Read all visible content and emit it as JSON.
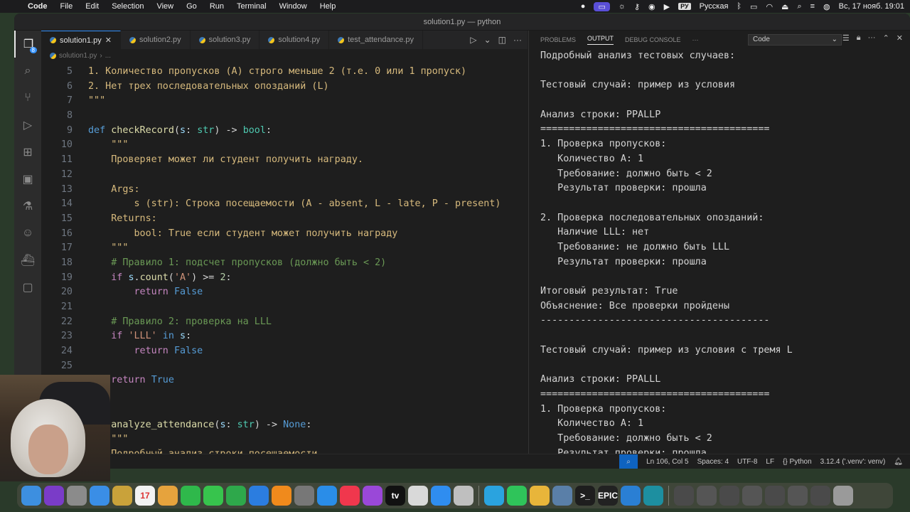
{
  "menubar": {
    "app": "Code",
    "items": [
      "File",
      "Edit",
      "Selection",
      "View",
      "Go",
      "Run",
      "Terminal",
      "Window",
      "Help"
    ],
    "input_source_badge": "РУ",
    "input_source": "Русская",
    "datetime": "Вс, 17 нояб.  19:01"
  },
  "window": {
    "title": "solution1.py — python"
  },
  "activity_bar": {
    "icons": [
      "files-icon",
      "search-icon",
      "source-control-icon",
      "run-debug-icon",
      "extensions-icon",
      "remote-explorer-icon",
      "testing-icon",
      "copilot-icon",
      "docker-icon",
      "comments-icon"
    ],
    "explorer_badge": "8"
  },
  "editor": {
    "tabs": [
      {
        "label": "solution1.py",
        "active": true
      },
      {
        "label": "solution2.py",
        "active": false
      },
      {
        "label": "solution3.py",
        "active": false
      },
      {
        "label": "solution4.py",
        "active": false
      },
      {
        "label": "test_attendance.py",
        "active": false
      }
    ],
    "breadcrumb": [
      "solution1.py",
      "..."
    ],
    "lines": [
      {
        "n": "5",
        "segs": [
          [
            "doc",
            "1. Количество пропусков (A) строго меньше 2 (т.е. 0 или 1 пропуск)"
          ]
        ]
      },
      {
        "n": "6",
        "segs": [
          [
            "doc",
            "2. Нет трех последовательных опозданий (L)"
          ]
        ]
      },
      {
        "n": "7",
        "segs": [
          [
            "doc",
            "\"\"\""
          ]
        ]
      },
      {
        "n": "8",
        "segs": []
      },
      {
        "n": "9",
        "segs": [
          [
            "kw",
            "def "
          ],
          [
            "fn",
            "checkRecord"
          ],
          [
            "",
            "("
          ],
          [
            "var",
            "s"
          ],
          [
            "",
            ": "
          ],
          [
            "ty",
            "str"
          ],
          [
            "",
            ") -> "
          ],
          [
            "ty",
            "bool"
          ],
          [
            "",
            ":"
          ]
        ]
      },
      {
        "n": "10",
        "segs": [
          [
            "doc",
            "    \"\"\""
          ]
        ]
      },
      {
        "n": "11",
        "segs": [
          [
            "doc",
            "    Проверяет может ли студент получить награду."
          ]
        ]
      },
      {
        "n": "12",
        "segs": []
      },
      {
        "n": "13",
        "segs": [
          [
            "doc",
            "    Args:"
          ]
        ]
      },
      {
        "n": "14",
        "segs": [
          [
            "doc",
            "        s (str): Строка посещаемости (A - absent, L - late, P - present)"
          ]
        ]
      },
      {
        "n": "15",
        "segs": [
          [
            "doc",
            "    Returns:"
          ]
        ]
      },
      {
        "n": "16",
        "segs": [
          [
            "doc",
            "        bool: True если студент может получить награду"
          ]
        ]
      },
      {
        "n": "17",
        "segs": [
          [
            "doc",
            "    \"\"\""
          ]
        ]
      },
      {
        "n": "18",
        "segs": [
          [
            "cm",
            "    # Правило 1: подсчет пропусков (должно быть < 2)"
          ]
        ]
      },
      {
        "n": "19",
        "segs": [
          [
            "ctl",
            "    if "
          ],
          [
            "var",
            "s"
          ],
          [
            "",
            "."
          ],
          [
            "fn",
            "count"
          ],
          [
            "",
            "("
          ],
          [
            "str",
            "'A'"
          ],
          [
            "",
            ") >= "
          ],
          [
            "num",
            "2"
          ],
          [
            "",
            ":"
          ]
        ]
      },
      {
        "n": "20",
        "segs": [
          [
            "ctl",
            "        return "
          ],
          [
            "kw",
            "False"
          ]
        ]
      },
      {
        "n": "21",
        "segs": []
      },
      {
        "n": "22",
        "segs": [
          [
            "cm",
            "    # Правило 2: проверка на LLL"
          ]
        ]
      },
      {
        "n": "23",
        "segs": [
          [
            "ctl",
            "    if "
          ],
          [
            "str",
            "'LLL'"
          ],
          [
            "kw",
            " in "
          ],
          [
            "var",
            "s"
          ],
          [
            "",
            ":"
          ]
        ]
      },
      {
        "n": "24",
        "segs": [
          [
            "ctl",
            "        return "
          ],
          [
            "kw",
            "False"
          ]
        ]
      },
      {
        "n": "25",
        "segs": []
      },
      {
        "n": "",
        "segs": [
          [
            "ctl",
            "    return "
          ],
          [
            "kw",
            "True"
          ]
        ]
      },
      {
        "n": "",
        "segs": []
      },
      {
        "n": "",
        "segs": []
      },
      {
        "n": "",
        "segs": [
          [
            "kw",
            "def "
          ],
          [
            "fn",
            "analyze_attendance"
          ],
          [
            "",
            "("
          ],
          [
            "var",
            "s"
          ],
          [
            "",
            ": "
          ],
          [
            "ty",
            "str"
          ],
          [
            "",
            ") -> "
          ],
          [
            "kw",
            "None"
          ],
          [
            "",
            ":"
          ]
        ]
      },
      {
        "n": "",
        "segs": [
          [
            "doc",
            "    \"\"\""
          ]
        ]
      },
      {
        "n": "",
        "segs": [
          [
            "doc",
            "    Подробный анализ строки посещаемости"
          ]
        ]
      }
    ]
  },
  "panel": {
    "tabs": [
      "PROBLEMS",
      "OUTPUT",
      "DEBUG CONSOLE",
      "···"
    ],
    "active_tab": "OUTPUT",
    "channel": "Code",
    "output_lines": [
      "Подробный анализ тестовых случаев:",
      "",
      "Тестовый случай: пример из условия",
      "",
      "Анализ строки: PPALLP",
      "========================================",
      "1. Проверка пропусков:",
      "   Количество A: 1",
      "   Требование: должно быть < 2",
      "   Результат проверки: прошла",
      "",
      "2. Проверка последовательных опозданий:",
      "   Наличие LLL: нет",
      "   Требование: не должно быть LLL",
      "   Результат проверки: прошла",
      "",
      "Итоговый результат: True",
      "Объяснение: Все проверки пройдены",
      "----------------------------------------",
      "",
      "Тестовый случай: пример из условия с тремя L",
      "",
      "Анализ строки: PPALLL",
      "========================================",
      "1. Проверка пропусков:",
      "   Количество A: 1",
      "   Требование: должно быть < 2",
      "   Результат проверки: прошла"
    ]
  },
  "statusbar": {
    "position": "Ln 106, Col 5",
    "indent": "Spaces: 4",
    "encoding": "UTF-8",
    "eol": "LF",
    "language": "{} Python",
    "interpreter": "3.12.4 ('.venv': venv)"
  },
  "dock": {
    "apps": [
      {
        "name": "finder",
        "color": "#3d8fe0"
      },
      {
        "name": "siri",
        "color": "#7a3cc8"
      },
      {
        "name": "launchpad",
        "color": "#8b8b8b"
      },
      {
        "name": "mail",
        "color": "#3a8ee6"
      },
      {
        "name": "notes",
        "color": "#c9a23a"
      },
      {
        "name": "calendar",
        "color": "#f2f2f2",
        "label": "17"
      },
      {
        "name": "photos",
        "color": "#e6a33d"
      },
      {
        "name": "facetime",
        "color": "#2fb84b"
      },
      {
        "name": "messages",
        "color": "#37c44d"
      },
      {
        "name": "numbers",
        "color": "#2ea84b"
      },
      {
        "name": "keynote",
        "color": "#2b7de0"
      },
      {
        "name": "books",
        "color": "#f08a1c"
      },
      {
        "name": "system-settings",
        "color": "#777777"
      },
      {
        "name": "safari",
        "color": "#2a8de8"
      },
      {
        "name": "music",
        "color": "#f0374d"
      },
      {
        "name": "podcasts",
        "color": "#9a48d8"
      },
      {
        "name": "tv",
        "color": "#111111",
        "label": "tv"
      },
      {
        "name": "textedit",
        "color": "#d9d9d9"
      },
      {
        "name": "freeform",
        "color": "#2f8df0"
      },
      {
        "name": "script-editor",
        "color": "#bfbfbf"
      },
      {
        "name": "telegram",
        "color": "#2aa3df"
      },
      {
        "name": "whatsapp",
        "color": "#2fc45a"
      },
      {
        "name": "chrome",
        "color": "#e8b53a"
      },
      {
        "name": "preview",
        "color": "#5a7fa8"
      },
      {
        "name": "terminal",
        "color": "#1e1e1e",
        "label": ">_"
      },
      {
        "name": "epic-games",
        "color": "#222222",
        "label": "EPIC"
      },
      {
        "name": "vscode",
        "color": "#2a7fd4"
      },
      {
        "name": "cursor",
        "color": "#1d8fa0"
      },
      {
        "name": "window-1",
        "color": "#4a4a4a"
      },
      {
        "name": "window-2",
        "color": "#555555"
      },
      {
        "name": "window-3",
        "color": "#4a4a4a"
      },
      {
        "name": "window-4",
        "color": "#555555"
      },
      {
        "name": "window-5",
        "color": "#4a4a4a"
      },
      {
        "name": "window-6",
        "color": "#555555"
      },
      {
        "name": "window-7",
        "color": "#4a4a4a"
      },
      {
        "name": "trash",
        "color": "#9a9a9a"
      }
    ]
  }
}
